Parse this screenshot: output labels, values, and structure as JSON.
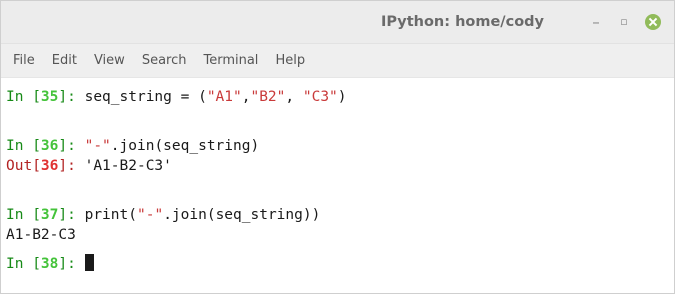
{
  "window": {
    "title": "IPython: home/cody",
    "minimize_label": "–",
    "maximize_label": "▫"
  },
  "menu": [
    "File",
    "Edit",
    "View",
    "Search",
    "Terminal",
    "Help"
  ],
  "terminal": {
    "line1": {
      "prompt_in": "In [",
      "num": "35",
      "prompt_end": "]: ",
      "code_a": "seq_string = (",
      "s1": "\"A1\"",
      "c1": ",",
      "s2": "\"B2\"",
      "c2": ", ",
      "s3": "\"C3\"",
      "code_b": ")"
    },
    "line2": {
      "prompt_in": "In [",
      "num": "36",
      "prompt_end": "]: ",
      "s1": "\"-\"",
      "code": ".join(seq_string)"
    },
    "line3": {
      "prompt_out": "Out[",
      "num": "36",
      "prompt_end": "]: ",
      "value": "'A1-B2-C3'"
    },
    "line4": {
      "prompt_in": "In [",
      "num": "37",
      "prompt_end": "]: ",
      "code_a": "print(",
      "s1": "\"-\"",
      "code_b": ".join(seq_string))"
    },
    "line5": {
      "value": "A1-B2-C3"
    },
    "line6": {
      "prompt_in": "In [",
      "num": "38",
      "prompt_end": "]: "
    }
  },
  "colors": {
    "prompt_in": "#178a17",
    "prompt_in_num": "#44c33a",
    "prompt_out": "#b22222",
    "prompt_out_num": "#e03131",
    "string": "#ba2121",
    "close_button": "#91bb5a"
  }
}
